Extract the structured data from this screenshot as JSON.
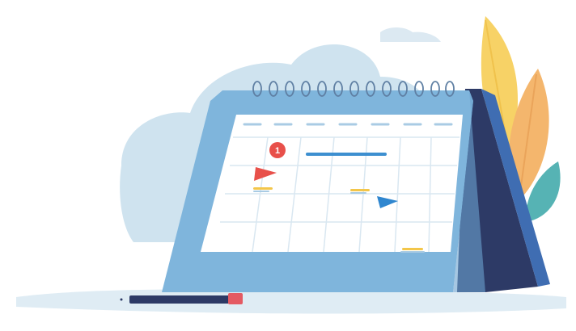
{
  "illustration": {
    "subject": "desk-calendar",
    "notification_badge": {
      "text": "1",
      "color": "#e8504a"
    },
    "colors": {
      "cloud": "#cfe3ef",
      "frame_front": "#7fb5dc",
      "frame_side": "#2d3a66",
      "page": "#ffffff",
      "grid_line": "#d9e7f1",
      "event_bar": "#3d8fd0",
      "flag_red": "#e8504a",
      "flag_blue": "#2f86cf",
      "marker_yellow": "#f3c64a",
      "leaf_yellow": "#f7d266",
      "leaf_orange": "#f4b66d",
      "leaf_teal": "#56b3b4",
      "pencil": "#2d3a66",
      "eraser": "#e45a63",
      "ground": "#cfe3ef"
    }
  }
}
